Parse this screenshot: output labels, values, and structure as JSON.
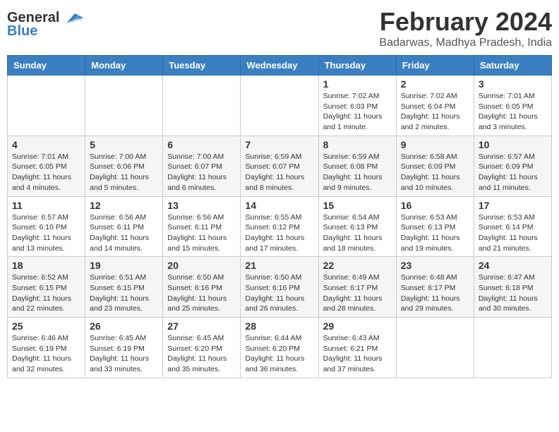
{
  "header": {
    "logo_general": "General",
    "logo_blue": "Blue",
    "title": "February 2024",
    "subtitle": "Badarwas, Madhya Pradesh, India"
  },
  "days_of_week": [
    "Sunday",
    "Monday",
    "Tuesday",
    "Wednesday",
    "Thursday",
    "Friday",
    "Saturday"
  ],
  "weeks": [
    [
      {
        "day": "",
        "info": ""
      },
      {
        "day": "",
        "info": ""
      },
      {
        "day": "",
        "info": ""
      },
      {
        "day": "",
        "info": ""
      },
      {
        "day": "1",
        "info": "Sunrise: 7:02 AM\nSunset: 6:03 PM\nDaylight: 11 hours and 1 minute."
      },
      {
        "day": "2",
        "info": "Sunrise: 7:02 AM\nSunset: 6:04 PM\nDaylight: 11 hours and 2 minutes."
      },
      {
        "day": "3",
        "info": "Sunrise: 7:01 AM\nSunset: 6:05 PM\nDaylight: 11 hours and 3 minutes."
      }
    ],
    [
      {
        "day": "4",
        "info": "Sunrise: 7:01 AM\nSunset: 6:05 PM\nDaylight: 11 hours and 4 minutes."
      },
      {
        "day": "5",
        "info": "Sunrise: 7:00 AM\nSunset: 6:06 PM\nDaylight: 11 hours and 5 minutes."
      },
      {
        "day": "6",
        "info": "Sunrise: 7:00 AM\nSunset: 6:07 PM\nDaylight: 11 hours and 6 minutes."
      },
      {
        "day": "7",
        "info": "Sunrise: 6:59 AM\nSunset: 6:07 PM\nDaylight: 11 hours and 8 minutes."
      },
      {
        "day": "8",
        "info": "Sunrise: 6:59 AM\nSunset: 6:08 PM\nDaylight: 11 hours and 9 minutes."
      },
      {
        "day": "9",
        "info": "Sunrise: 6:58 AM\nSunset: 6:09 PM\nDaylight: 11 hours and 10 minutes."
      },
      {
        "day": "10",
        "info": "Sunrise: 6:57 AM\nSunset: 6:09 PM\nDaylight: 11 hours and 11 minutes."
      }
    ],
    [
      {
        "day": "11",
        "info": "Sunrise: 6:57 AM\nSunset: 6:10 PM\nDaylight: 11 hours and 13 minutes."
      },
      {
        "day": "12",
        "info": "Sunrise: 6:56 AM\nSunset: 6:11 PM\nDaylight: 11 hours and 14 minutes."
      },
      {
        "day": "13",
        "info": "Sunrise: 6:56 AM\nSunset: 6:11 PM\nDaylight: 11 hours and 15 minutes."
      },
      {
        "day": "14",
        "info": "Sunrise: 6:55 AM\nSunset: 6:12 PM\nDaylight: 11 hours and 17 minutes."
      },
      {
        "day": "15",
        "info": "Sunrise: 6:54 AM\nSunset: 6:13 PM\nDaylight: 11 hours and 18 minutes."
      },
      {
        "day": "16",
        "info": "Sunrise: 6:53 AM\nSunset: 6:13 PM\nDaylight: 11 hours and 19 minutes."
      },
      {
        "day": "17",
        "info": "Sunrise: 6:53 AM\nSunset: 6:14 PM\nDaylight: 11 hours and 21 minutes."
      }
    ],
    [
      {
        "day": "18",
        "info": "Sunrise: 6:52 AM\nSunset: 6:15 PM\nDaylight: 11 hours and 22 minutes."
      },
      {
        "day": "19",
        "info": "Sunrise: 6:51 AM\nSunset: 6:15 PM\nDaylight: 11 hours and 23 minutes."
      },
      {
        "day": "20",
        "info": "Sunrise: 6:50 AM\nSunset: 6:16 PM\nDaylight: 11 hours and 25 minutes."
      },
      {
        "day": "21",
        "info": "Sunrise: 6:50 AM\nSunset: 6:16 PM\nDaylight: 11 hours and 26 minutes."
      },
      {
        "day": "22",
        "info": "Sunrise: 6:49 AM\nSunset: 6:17 PM\nDaylight: 11 hours and 28 minutes."
      },
      {
        "day": "23",
        "info": "Sunrise: 6:48 AM\nSunset: 6:17 PM\nDaylight: 11 hours and 29 minutes."
      },
      {
        "day": "24",
        "info": "Sunrise: 6:47 AM\nSunset: 6:18 PM\nDaylight: 11 hours and 30 minutes."
      }
    ],
    [
      {
        "day": "25",
        "info": "Sunrise: 6:46 AM\nSunset: 6:19 PM\nDaylight: 11 hours and 32 minutes."
      },
      {
        "day": "26",
        "info": "Sunrise: 6:45 AM\nSunset: 6:19 PM\nDaylight: 11 hours and 33 minutes."
      },
      {
        "day": "27",
        "info": "Sunrise: 6:45 AM\nSunset: 6:20 PM\nDaylight: 11 hours and 35 minutes."
      },
      {
        "day": "28",
        "info": "Sunrise: 6:44 AM\nSunset: 6:20 PM\nDaylight: 11 hours and 36 minutes."
      },
      {
        "day": "29",
        "info": "Sunrise: 6:43 AM\nSunset: 6:21 PM\nDaylight: 11 hours and 37 minutes."
      },
      {
        "day": "",
        "info": ""
      },
      {
        "day": "",
        "info": ""
      }
    ]
  ]
}
